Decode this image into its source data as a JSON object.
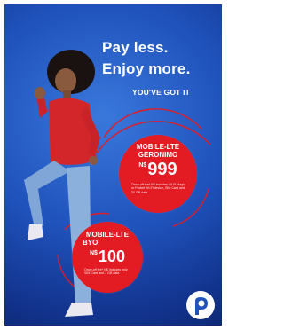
{
  "poster": {
    "headline_line1": "Pay less.",
    "headline_line2": "Enjoy more.",
    "tagline": "YOU'VE GOT IT",
    "colors": {
      "background": "#1f52bb",
      "badge": "#e31b23",
      "text": "#ffffff"
    }
  },
  "offers": [
    {
      "name_line1": "MOBILE-LTE",
      "name_line2": "GERONIMO",
      "currency": "N$",
      "price": "999",
      "fine_print": "Once-off fee* N$ includes Wi-Fi Magic or Pocket Wi-Fi device, SIM Card and 20 GB data"
    },
    {
      "name_line1": "MOBILE-LTE",
      "name_line2": "BYO",
      "currency": "N$",
      "price": "100",
      "fine_print": "Once-off fee* N$ Includes only SIM Card and 1 GB data"
    }
  ],
  "logo": {
    "icon": "paratus-p-logo-icon"
  }
}
